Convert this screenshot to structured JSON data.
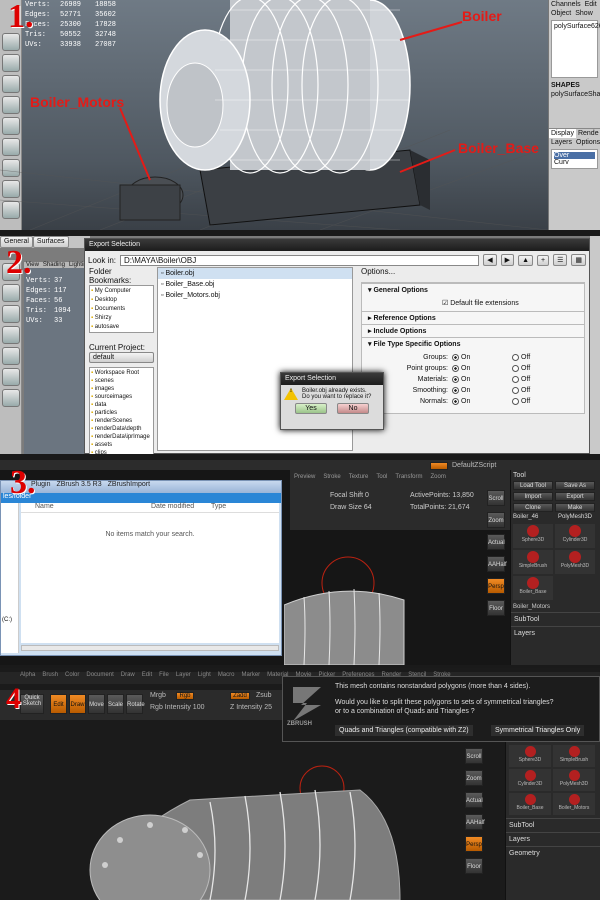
{
  "steps": [
    "1.",
    "2.",
    "3.",
    "4"
  ],
  "panel1": {
    "stats": [
      {
        "label": "Verts:",
        "a": "26989",
        "b": "18858"
      },
      {
        "label": "Edges:",
        "a": "52771",
        "b": "35602"
      },
      {
        "label": "Faces:",
        "a": "25300",
        "b": "17828"
      },
      {
        "label": "Tris:",
        "a": "50552",
        "b": "32748"
      },
      {
        "label": "UVs:",
        "a": "33938",
        "b": "27087"
      }
    ],
    "annotations": {
      "boiler": "Boiler",
      "motors": "Boiler_Motors",
      "base": "Boiler_Base"
    },
    "right": {
      "tabs": [
        "Channels",
        "Edit",
        "Object",
        "Show"
      ],
      "object_name": "polySurface626",
      "shapes_label": "SHAPES",
      "shape_name": "polySurfaceSha",
      "bottom_tabs": [
        "Display",
        "Rende"
      ],
      "layer_menu": [
        "Layers",
        "Options"
      ],
      "layer_items": [
        "Over",
        "Curv"
      ]
    }
  },
  "panel2": {
    "maya_tabs": [
      "General",
      "Surfaces"
    ],
    "maya_tabs2": [
      "View",
      "Shading",
      "Lighting"
    ],
    "stats": [
      {
        "label": "Verts:",
        "a": "37"
      },
      {
        "label": "Edges:",
        "a": "117"
      },
      {
        "label": "Faces:",
        "a": "56"
      },
      {
        "label": "Tris:",
        "a": "1094"
      },
      {
        "label": "UVs:",
        "a": "33"
      }
    ],
    "dialog_title": "Export Selection",
    "look_in_label": "Look in:",
    "path": "D:\\MAYA\\Boiler\\OBJ",
    "folder_bookmarks_label": "Folder Bookmarks:",
    "bookmarks": [
      "My Computer",
      "Desktop",
      "Documents",
      "Shirzy",
      "autosave"
    ],
    "current_project_label": "Current Project:",
    "project": "default",
    "project_folders": [
      "Workspace Root",
      "scenes",
      "images",
      "sourceimages",
      "data",
      "particles",
      "renderScenes",
      "renderData\\depth",
      "renderData\\iprImage",
      "assets",
      "clips"
    ],
    "files": [
      "Boiler.obj",
      "Boiler_Base.obj",
      "Boiler_Motors.obj"
    ],
    "options_label": "Options...",
    "general_options": "General Options",
    "default_ext": "Default file extensions",
    "ref_options": "Reference Options",
    "include_options": "Include Options",
    "file_type_options": "File Type Specific Options",
    "opts": [
      {
        "label": "Groups:",
        "on": "On",
        "off": "Off"
      },
      {
        "label": "Point groups:",
        "on": "On",
        "off": "Off"
      },
      {
        "label": "Materials:",
        "on": "On",
        "off": "Off"
      },
      {
        "label": "Smoothing:",
        "on": "On",
        "off": "Off"
      },
      {
        "label": "Normals:",
        "on": "On",
        "off": "Off"
      }
    ],
    "popup_title": "Export Selection",
    "popup_msg1": "Boiler.obj already exists.",
    "popup_msg2": "Do you want to replace it?",
    "yes": "Yes",
    "no": "No",
    "right_label": "polySurface626"
  },
  "panel3": {
    "crumbs": [
      "Plugin",
      "ZBrush 3.5 R3",
      "ZBrushImport"
    ],
    "dialog_left_label": "les/folder",
    "cols": [
      "Name",
      "Date modified",
      "Type"
    ],
    "empty_msg": "No items match your search.",
    "left_edge_label": "(C:)",
    "top_menu": [
      "Preview",
      "Stroke",
      "Texture",
      "Tool",
      "Transform",
      "Zoom"
    ],
    "menu_items": [
      "Zplugin",
      "Zscript",
      "Help",
      "Alpha",
      "Brush",
      "Color",
      "Document",
      "Draw"
    ],
    "hidden_label": "Hide Script",
    "default_script": "DefaultZScript",
    "focal_shift": "Focal Shift 0",
    "draw_size": "Draw Size 64",
    "active_points": "ActivePoints: 13,850",
    "total_points": "TotalPoints: 21,674",
    "tool_title": "Tool",
    "tool_buttons": [
      "Load Tool",
      "Save As",
      "Import",
      "Export",
      "Clone",
      "Make PolyMesh3D"
    ],
    "tool_labels": [
      "Boiler_46",
      "Sphere3D",
      "Cylinder3D",
      "SimpleBrush",
      "PolyMesh3D",
      "Boiler_Base"
    ],
    "boiler_label": "Boiler_Motors",
    "subtool": "SubTool",
    "layers": "Layers",
    "side_labels": [
      "Scroll",
      "Zoom",
      "Actual",
      "AAHalf",
      "Persp",
      "Floor"
    ]
  },
  "panel4": {
    "menus": [
      "Alpha",
      "Brush",
      "Color",
      "Document",
      "Draw",
      "Edit",
      "File",
      "Layer",
      "Light",
      "Macro",
      "Marker",
      "Material",
      "Movie",
      "Picker",
      "Preferences",
      "Render",
      "Stencil",
      "Stroke"
    ],
    "quick_sketch": "Quick Sketch",
    "tools": [
      "Edit",
      "Draw",
      "Move",
      "Scale",
      "Rotate"
    ],
    "mrgb": "Mrgb",
    "rgb": "Rgb",
    "rgb_label": "Rgb Intensity 100",
    "zadd": "Zadd",
    "zsub": "Zsub",
    "z_intensity": "Z Intensity 25",
    "dialog_line1": "This mesh contains nonstandard polygons (more than 4 sides).",
    "dialog_line2": "Would you like to split these polygons to sets of symmetrical triangles?",
    "dialog_line3": "or to a combination of Quads and Triangles ?",
    "btn_quads": "Quads and Triangles (compatible with Z2)",
    "btn_sym": "Symmetrical Triangles Only",
    "zbrush_logo": "ZBRUSH",
    "tool_labels": [
      "Sphere3D",
      "SimpleBrush",
      "Cylinder3D",
      "PolyMesh3D",
      "Boiler_Base",
      "Boiler_Motors"
    ],
    "subtool": "SubTool",
    "layers": "Layers",
    "geometry": "Geometry"
  },
  "colors": {
    "annotation": "#e41b17",
    "zbrush_orange": "#f08a24",
    "maya_panel": "#c9c9c9"
  }
}
